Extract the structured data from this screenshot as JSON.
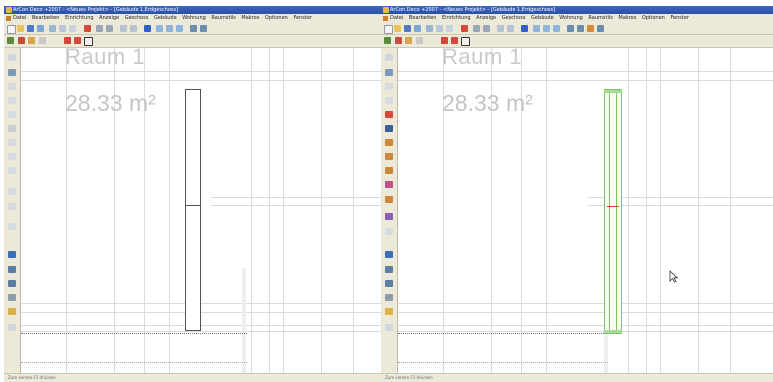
{
  "left_window": {
    "title": "ArCon Deco +2007 - <Neues Projekt> - [Gebäude 1,Erdgeschoss]",
    "menu": [
      "Datei",
      "Bearbeiten",
      "Einrichtung",
      "Anzeige",
      "Geschoss",
      "Gebäude",
      "Wohnung",
      "Raumstils",
      "Makros",
      "Optionen",
      "Fenster"
    ],
    "room_label": "Raum 1",
    "room_area": "28.33 m²",
    "status_text": "Zum Lernen F1 drücken"
  },
  "right_window": {
    "title": "ArCon Deco +2007 - <Neues Projekt> - [Gebäude 1,Erdgeschoss]",
    "menu": [
      "Datei",
      "Bearbeiten",
      "Einrichtung",
      "Anzeige",
      "Geschoss",
      "Gebäude",
      "Wohnung",
      "Raumstils",
      "Makros",
      "Optionen",
      "Fenster"
    ],
    "room_label": "Raum 1",
    "room_area": "28.33 m²",
    "status_text": "Zum Lernen F1 drücken"
  },
  "colors": {
    "titlebar": "#2a4fa6",
    "chrome": "#ece9d8",
    "selection": "#7fc46a",
    "selection_marker": "#d23a2a",
    "grid_line": "#d7dcdf"
  }
}
